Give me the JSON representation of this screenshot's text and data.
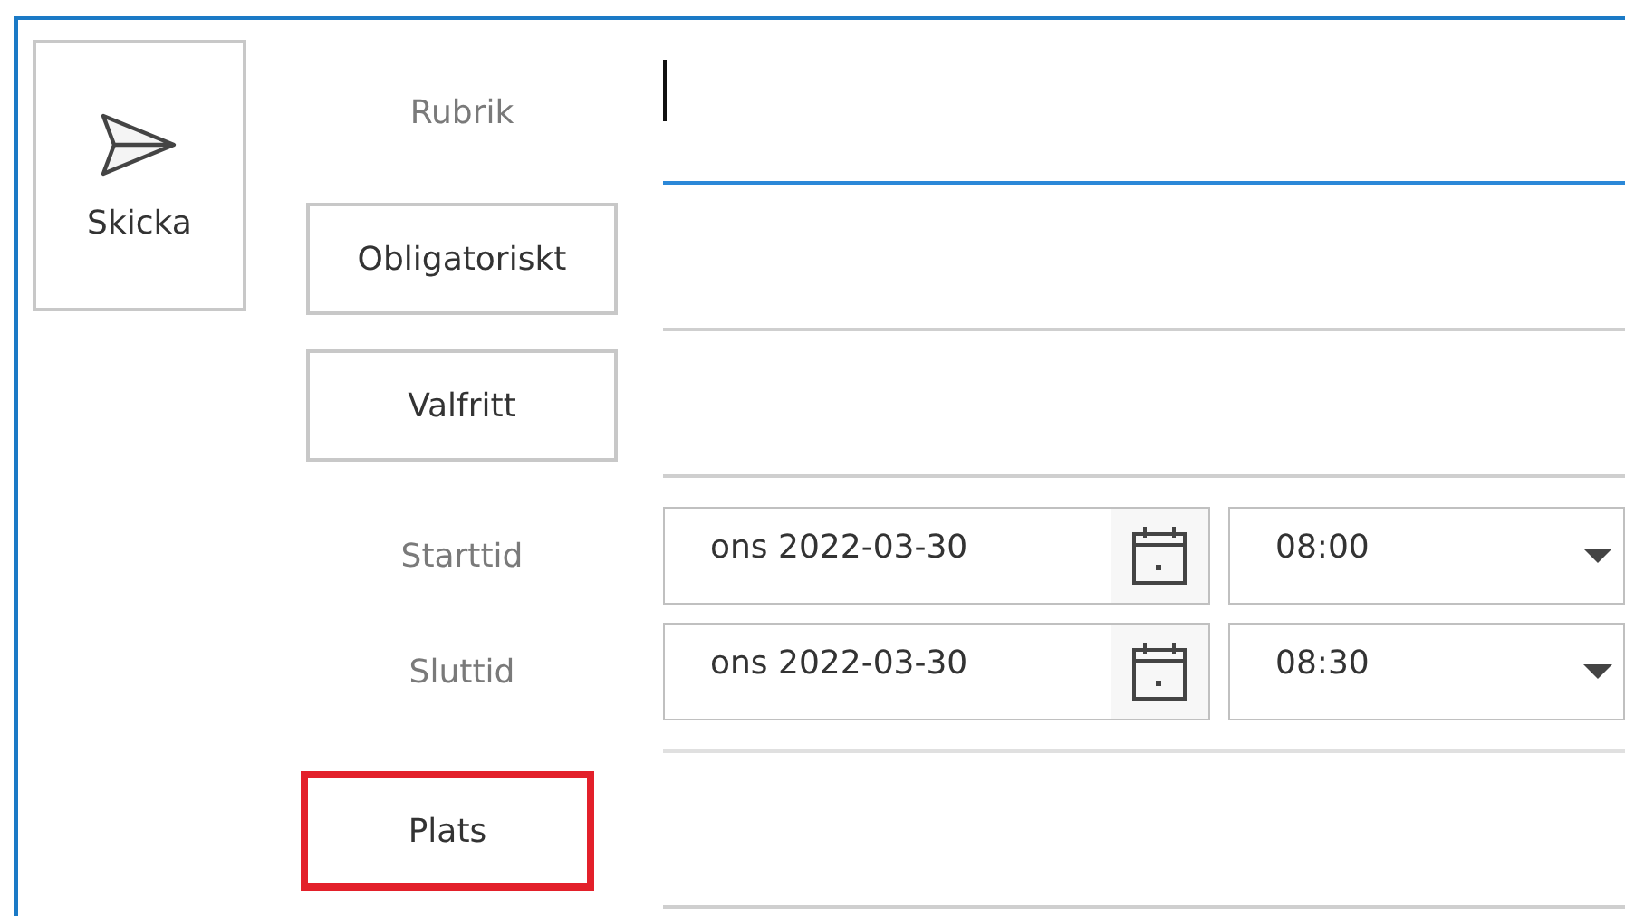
{
  "send_button": {
    "label": "Skicka"
  },
  "fields": [
    {
      "label": "Rubrik",
      "kind": "subject",
      "focused": true
    },
    {
      "label": "Obligatoriskt",
      "kind": "button"
    },
    {
      "label": "Valfritt",
      "kind": "button"
    }
  ],
  "times": [
    {
      "label": "Starttid",
      "date": "ons 2022-03-30",
      "time": "08:00"
    },
    {
      "label": "Sluttid",
      "date": "ons 2022-03-30",
      "time": "08:30"
    }
  ],
  "location": {
    "label": "Plats",
    "highlighted": true
  }
}
